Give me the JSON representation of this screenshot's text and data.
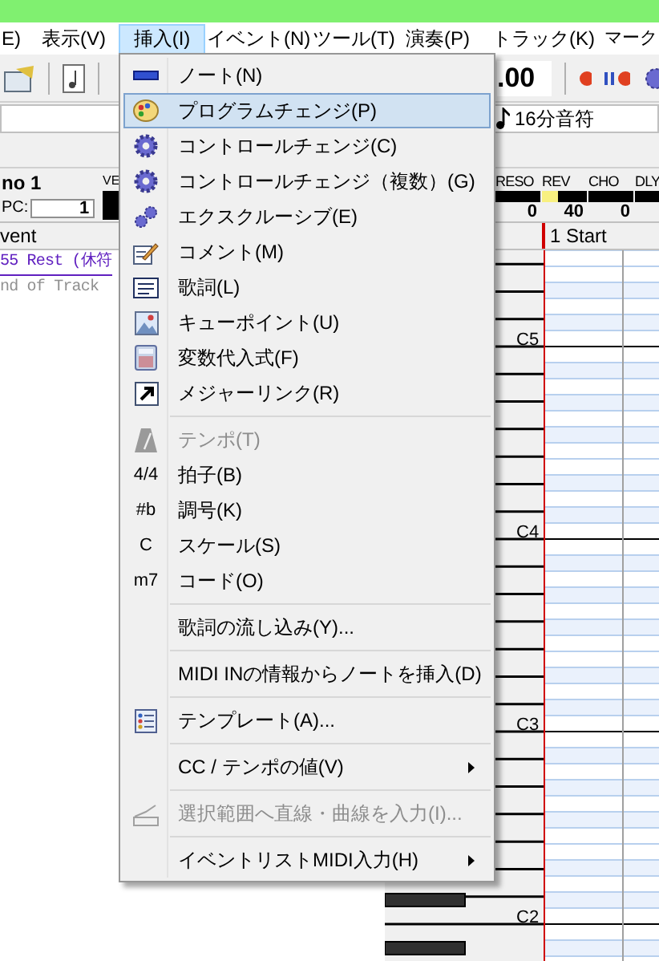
{
  "menu_bar": [
    {
      "label": "E)",
      "selected": false
    },
    {
      "label": "表示(V)",
      "selected": false
    },
    {
      "label": "挿入(I)",
      "selected": true
    },
    {
      "label": "イベント(N)",
      "selected": false
    },
    {
      "label": "ツール(T)",
      "selected": false
    },
    {
      "label": "演奏(P)",
      "selected": false
    },
    {
      "label": "トラック(K)",
      "selected": false
    },
    {
      "label": "マーク",
      "selected": false
    }
  ],
  "toolbar": {
    "counter": ".00",
    "note_length": "16分音符"
  },
  "track_header": {
    "name": "no 1",
    "pc_label": "PC:",
    "pc_value": "1",
    "column_3": "VE",
    "meters": [
      {
        "label": "RESO",
        "reading": "0"
      },
      {
        "label": "REV",
        "level": 0.35,
        "reading": "40"
      },
      {
        "label": "CHO",
        "reading": "0"
      },
      {
        "label": "DLY"
      }
    ]
  },
  "event_list": {
    "header": "vent",
    "rows": [
      {
        "text": "55 Rest (休符",
        "kind": "link"
      },
      {
        "text": "nd of Track",
        "kind": "end"
      }
    ]
  },
  "piano_roll": {
    "header": "1 Start",
    "key_labels": [
      "C5",
      "C4",
      "C3",
      "C2"
    ]
  },
  "menu": {
    "items": [
      {
        "kind": "item",
        "label": "ノート(N)",
        "selected": false,
        "disabled": false,
        "submenu": false
      },
      {
        "kind": "item",
        "label": "プログラムチェンジ(P)",
        "selected": true,
        "disabled": false,
        "submenu": false
      },
      {
        "kind": "item",
        "label": "コントロールチェンジ(C)",
        "selected": false,
        "disabled": false,
        "submenu": false
      },
      {
        "kind": "item",
        "label": "コントロールチェンジ（複数）(G)",
        "selected": false,
        "disabled": false,
        "submenu": false
      },
      {
        "kind": "item",
        "label": "エクスクルーシブ(E)",
        "selected": false,
        "disabled": false,
        "submenu": false
      },
      {
        "kind": "item",
        "label": "コメント(M)",
        "selected": false,
        "disabled": false,
        "submenu": false
      },
      {
        "kind": "item",
        "label": "歌詞(L)",
        "selected": false,
        "disabled": false,
        "submenu": false
      },
      {
        "kind": "item",
        "label": "キューポイント(U)",
        "selected": false,
        "disabled": false,
        "submenu": false
      },
      {
        "kind": "item",
        "label": "変数代入式(F)",
        "selected": false,
        "disabled": false,
        "submenu": false
      },
      {
        "kind": "item",
        "label": "メジャーリンク(R)",
        "selected": false,
        "disabled": false,
        "submenu": false
      },
      {
        "kind": "separator"
      },
      {
        "kind": "item",
        "label": "テンポ(T)",
        "selected": false,
        "disabled": true,
        "submenu": false
      },
      {
        "kind": "item",
        "label": "拍子(B)",
        "icon_text": "4/4",
        "selected": false,
        "disabled": false,
        "submenu": false
      },
      {
        "kind": "item",
        "label": "調号(K)",
        "icon_text": "#b",
        "selected": false,
        "disabled": false,
        "submenu": false
      },
      {
        "kind": "item",
        "label": "スケール(S)",
        "icon_text": "C",
        "selected": false,
        "disabled": false,
        "submenu": false
      },
      {
        "kind": "item",
        "label": "コード(O)",
        "icon_text": "m7",
        "selected": false,
        "disabled": false,
        "submenu": false
      },
      {
        "kind": "separator"
      },
      {
        "kind": "item",
        "label": "歌詞の流し込み(Y)...",
        "selected": false,
        "disabled": false,
        "submenu": false
      },
      {
        "kind": "separator"
      },
      {
        "kind": "item",
        "label": "MIDI INの情報からノートを挿入(D)",
        "selected": false,
        "disabled": false,
        "submenu": false
      },
      {
        "kind": "separator"
      },
      {
        "kind": "item",
        "label": "テンプレート(A)...",
        "selected": false,
        "disabled": false,
        "submenu": false
      },
      {
        "kind": "separator"
      },
      {
        "kind": "item",
        "label": "CC / テンポの値(V)",
        "selected": false,
        "disabled": false,
        "submenu": true
      },
      {
        "kind": "separator"
      },
      {
        "kind": "item",
        "label": "選択範囲へ直線・曲線を入力(I)...",
        "selected": false,
        "disabled": true,
        "submenu": false
      },
      {
        "kind": "separator"
      },
      {
        "kind": "item",
        "label": "イベントリストMIDI入力(H)",
        "selected": false,
        "disabled": false,
        "submenu": true
      }
    ]
  }
}
